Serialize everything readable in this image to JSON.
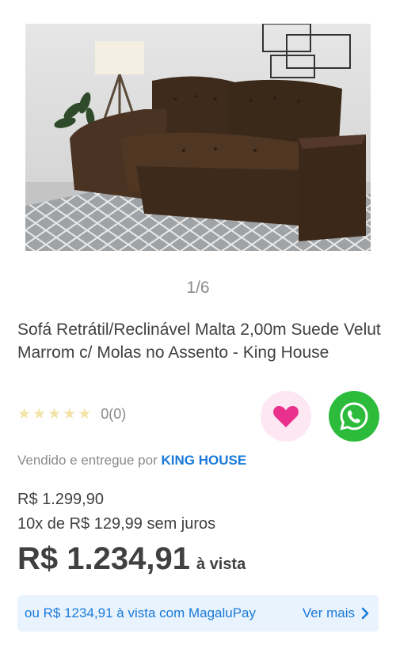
{
  "gallery": {
    "counter": "1/6"
  },
  "product": {
    "title": "Sofá Retrátil/Reclinável Malta 2,00m Suede Velut Marrom c/ Molas no Assento - King House",
    "rating_count": "0(0)"
  },
  "seller": {
    "prefix": "Vendido e entregue por",
    "name": "KING HOUSE"
  },
  "pricing": {
    "old_price": "R$ 1.299,90",
    "installments": "10x de R$ 129,99 sem juros",
    "price": "R$ 1.234,91",
    "price_suffix": "à vista"
  },
  "magalupay": {
    "text": "ou R$ 1234,91 à vista com MagaluPay",
    "link_label": "Ver mais"
  },
  "icons": {
    "favorite": "heart-icon",
    "whatsapp": "whatsapp-icon",
    "chevron": "chevron-right-icon"
  },
  "colors": {
    "link_blue": "#1a7ad9",
    "heart_pink": "#e8308c",
    "whatsapp_green": "#2dbb3b",
    "banner_bg": "#e9f3fd"
  }
}
